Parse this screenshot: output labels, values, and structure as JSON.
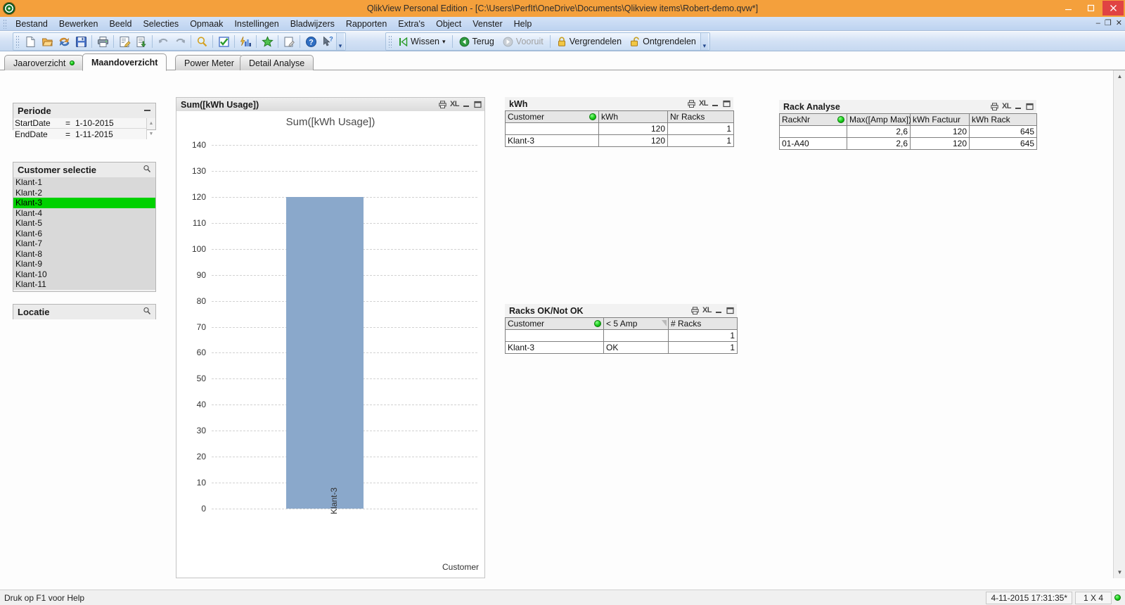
{
  "window": {
    "title": "QlikView Personal Edition - [C:\\Users\\PerfIt\\OneDrive\\Documents\\Qlikview items\\Robert-demo.qvw*]",
    "minimize_label": "–",
    "maximize_label": "❐",
    "close_label": "✕"
  },
  "menubar": {
    "items": [
      {
        "label": "Bestand",
        "accel": "B"
      },
      {
        "label": "Bewerken",
        "accel": "w"
      },
      {
        "label": "Beeld",
        "accel": "d"
      },
      {
        "label": "Selecties",
        "accel": "S"
      },
      {
        "label": "Opmaak",
        "accel": "m"
      },
      {
        "label": "Instellingen",
        "accel": "I"
      },
      {
        "label": "Bladwijzers",
        "accel": "d"
      },
      {
        "label": "Rapporten",
        "accel": "R"
      },
      {
        "label": "Extra's",
        "accel": "E"
      },
      {
        "label": "Object",
        "accel": "O"
      },
      {
        "label": "Venster",
        "accel": "V"
      },
      {
        "label": "Help",
        "accel": "H"
      }
    ],
    "min_label": "–",
    "restore_label": "❐",
    "close_label": "✕"
  },
  "toolbar": {
    "buttons": [
      {
        "name": "new-document",
        "icon": "page"
      },
      {
        "name": "open-document",
        "icon": "folder"
      },
      {
        "name": "reload",
        "icon": "refresh"
      },
      {
        "name": "save",
        "icon": "floppy"
      },
      {
        "name": "print",
        "icon": "printer"
      },
      {
        "name": "edit-script",
        "icon": "script"
      },
      {
        "name": "table-viewer",
        "icon": "table-down"
      },
      {
        "name": "undo",
        "icon": "undo"
      },
      {
        "name": "redo",
        "icon": "redo"
      },
      {
        "name": "search",
        "icon": "magnifier"
      },
      {
        "name": "current-selections",
        "icon": "checkbox"
      },
      {
        "name": "charts",
        "icon": "barchart"
      },
      {
        "name": "add-bookmark",
        "icon": "star"
      },
      {
        "name": "edit-module",
        "icon": "notepad"
      },
      {
        "name": "help",
        "icon": "question"
      },
      {
        "name": "context-help",
        "icon": "arrow-question"
      }
    ],
    "nav": {
      "clear_label": "Wissen",
      "clear_dropdown": "▾",
      "back_label": "Terug",
      "forward_label": "Vooruit",
      "forward_disabled": true,
      "lock_label": "Vergrendelen",
      "unlock_label": "Ontgrendelen"
    },
    "overflow_label": "▾"
  },
  "tabs": [
    {
      "label": "Jaaroverzicht",
      "active": false,
      "indicator": true
    },
    {
      "label": "Maandoverzicht",
      "active": true,
      "indicator": false
    },
    {
      "label": "Power Meter",
      "active": false,
      "indicator": false
    },
    {
      "label": "Detail Analyse",
      "active": false,
      "indicator": false
    }
  ],
  "periode": {
    "title": "Periode",
    "minimize_icon": "minimize-icon",
    "rows": [
      {
        "label": "StartDate",
        "operator": "=",
        "value": "1-10-2015"
      },
      {
        "label": "EndDate",
        "operator": "=",
        "value": "1-11-2015"
      }
    ]
  },
  "customer_selectie": {
    "title": "Customer selectie",
    "search_icon": "magnifier-icon",
    "items": [
      {
        "label": "Klant-1",
        "selected": false
      },
      {
        "label": "Klant-2",
        "selected": false
      },
      {
        "label": "Klant-3",
        "selected": true
      },
      {
        "label": "Klant-4",
        "selected": false
      },
      {
        "label": "Klant-5",
        "selected": false
      },
      {
        "label": "Klant-6",
        "selected": false
      },
      {
        "label": "Klant-7",
        "selected": false
      },
      {
        "label": "Klant-8",
        "selected": false
      },
      {
        "label": "Klant-9",
        "selected": false
      },
      {
        "label": "Klant-10",
        "selected": false
      },
      {
        "label": "Klant-11",
        "selected": false
      }
    ]
  },
  "locatie": {
    "title": "Locatie",
    "search_icon": "magnifier-icon"
  },
  "chart_object": {
    "caption": "Sum([kWh Usage])",
    "icons": {
      "print": "print-icon",
      "excel": "XL",
      "minimize": "–",
      "maximize": "❐"
    }
  },
  "chart_data": {
    "type": "bar",
    "title": "Sum([kWh Usage])",
    "categories": [
      "Klant-3"
    ],
    "values": [
      120
    ],
    "xlabel": "Customer",
    "ylabel": "",
    "ylim": [
      0,
      140
    ],
    "ytick_step": 10,
    "yticks": [
      0,
      10,
      20,
      30,
      40,
      50,
      60,
      70,
      80,
      90,
      100,
      110,
      120,
      130,
      140
    ],
    "grid": true,
    "legend": "none",
    "bar_color": "#8aa8cb"
  },
  "kwh_table": {
    "caption": "kWh",
    "icons": {
      "print": "print-icon",
      "excel": "XL",
      "minimize": "–",
      "maximize": "❐"
    },
    "columns": [
      "Customer",
      "kWh",
      "Nr Racks"
    ],
    "rows": [
      {
        "customer": "",
        "kwh": "120",
        "nr_racks": "1"
      },
      {
        "customer": "Klant-3",
        "kwh": "120",
        "nr_racks": "1"
      }
    ]
  },
  "racks_ok_table": {
    "caption": "Racks OK/Not OK",
    "icons": {
      "print": "print-icon",
      "excel": "XL",
      "minimize": "–",
      "maximize": "❐"
    },
    "columns": [
      "Customer",
      "< 5 Amp",
      "# Racks"
    ],
    "rows": [
      {
        "customer": "",
        "amp": "",
        "racks": "1"
      },
      {
        "customer": "Klant-3",
        "amp": "OK",
        "racks": "1"
      }
    ]
  },
  "rack_analyse_table": {
    "caption": "Rack Analyse",
    "icons": {
      "print": "print-icon",
      "excel": "XL",
      "minimize": "–",
      "maximize": "❐"
    },
    "columns": [
      "RackNr",
      "Max([Amp Max])",
      "kWh Factuur",
      "kWh Rack"
    ],
    "rows": [
      {
        "racknr": "",
        "amp_max": "2,6",
        "kwh_factuur": "120",
        "kwh_rack": "645"
      },
      {
        "racknr": "01-A40",
        "amp_max": "2,6",
        "kwh_factuur": "120",
        "kwh_rack": "645"
      }
    ]
  },
  "statusbar": {
    "hint": "Druk op F1 voor Help",
    "timestamp": "4-11-2015 17:31:35*",
    "selection_count": "1 X 4",
    "indicator": "green-status-dot"
  },
  "scrollbar": {
    "up_label": "▲",
    "down_label": "▼"
  }
}
